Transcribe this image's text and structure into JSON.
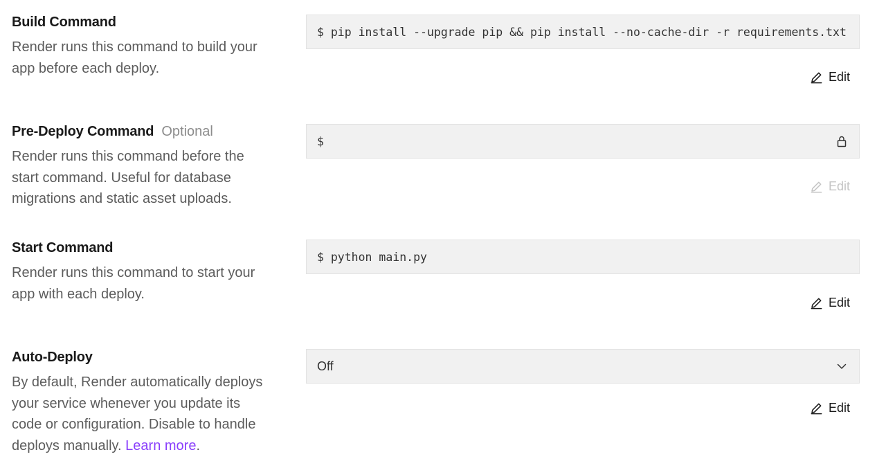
{
  "build": {
    "title": "Build Command",
    "description": "Render runs this command to build your app before each deploy.",
    "prompt": "$",
    "command": "pip install --upgrade pip && pip install --no-cache-dir -r requirements.txt",
    "edit_label": "Edit"
  },
  "predeploy": {
    "title": "Pre-Deploy Command",
    "optional_label": "Optional",
    "description": "Render runs this command before the start command. Useful for database migrations and static asset uploads.",
    "prompt": "$",
    "command": "",
    "edit_label": "Edit",
    "lock_icon": "lock-icon"
  },
  "start": {
    "title": "Start Command",
    "description": "Render runs this command to start your app with each deploy.",
    "prompt": "$",
    "command": "python main.py",
    "edit_label": "Edit"
  },
  "autodeploy": {
    "title": "Auto-Deploy",
    "description_text": "By default, Render automatically deploys your service whenever you update its code or configuration. Disable to handle deploys manually.",
    "learn_more_label": "Learn more",
    "trailing_period": ".",
    "selected_value": "Off",
    "edit_label": "Edit",
    "chevron_icon": "chevron-down-icon"
  },
  "colors": {
    "link": "#8a3ffc",
    "field_bg": "#f1f1f1",
    "muted_text": "#5c5c5c",
    "disabled_text": "#c4c4c4"
  }
}
